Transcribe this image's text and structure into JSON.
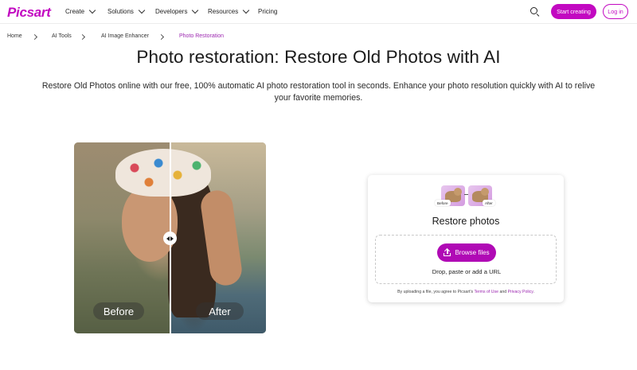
{
  "header": {
    "logo": "Picsart",
    "nav": [
      {
        "label": "Create"
      },
      {
        "label": "Solutions"
      },
      {
        "label": "Developers"
      },
      {
        "label": "Resources"
      },
      {
        "label": "Pricing"
      }
    ],
    "start_creating": "Start creating",
    "login": "Log in"
  },
  "breadcrumb": [
    "Home",
    "AI Tools",
    "AI Image Enhancer",
    "Photo Restoration"
  ],
  "page": {
    "title": "Photo restoration: Restore Old Photos with AI",
    "subtitle": "Restore Old Photos online with our free, 100% automatic AI photo restoration tool in seconds. Enhance your photo resolution quickly with AI to relive your favorite memories."
  },
  "compare": {
    "before_label": "Before",
    "after_label": "After"
  },
  "upload": {
    "thumb_before": "Before",
    "thumb_after": "After",
    "title": "Restore photos",
    "browse": "Browse files",
    "drop_text": "Drop, paste or add a URL",
    "terms_prefix": "By uploading a file, you agree to Picsart's",
    "terms_link": "Terms of Use",
    "terms_and": "and",
    "privacy_link": "Privacy Policy",
    "terms_suffix": "."
  },
  "colors": {
    "brand": "#c209c1",
    "browse": "#b00ab5",
    "breadcrumb_active": "#9c27b0"
  }
}
